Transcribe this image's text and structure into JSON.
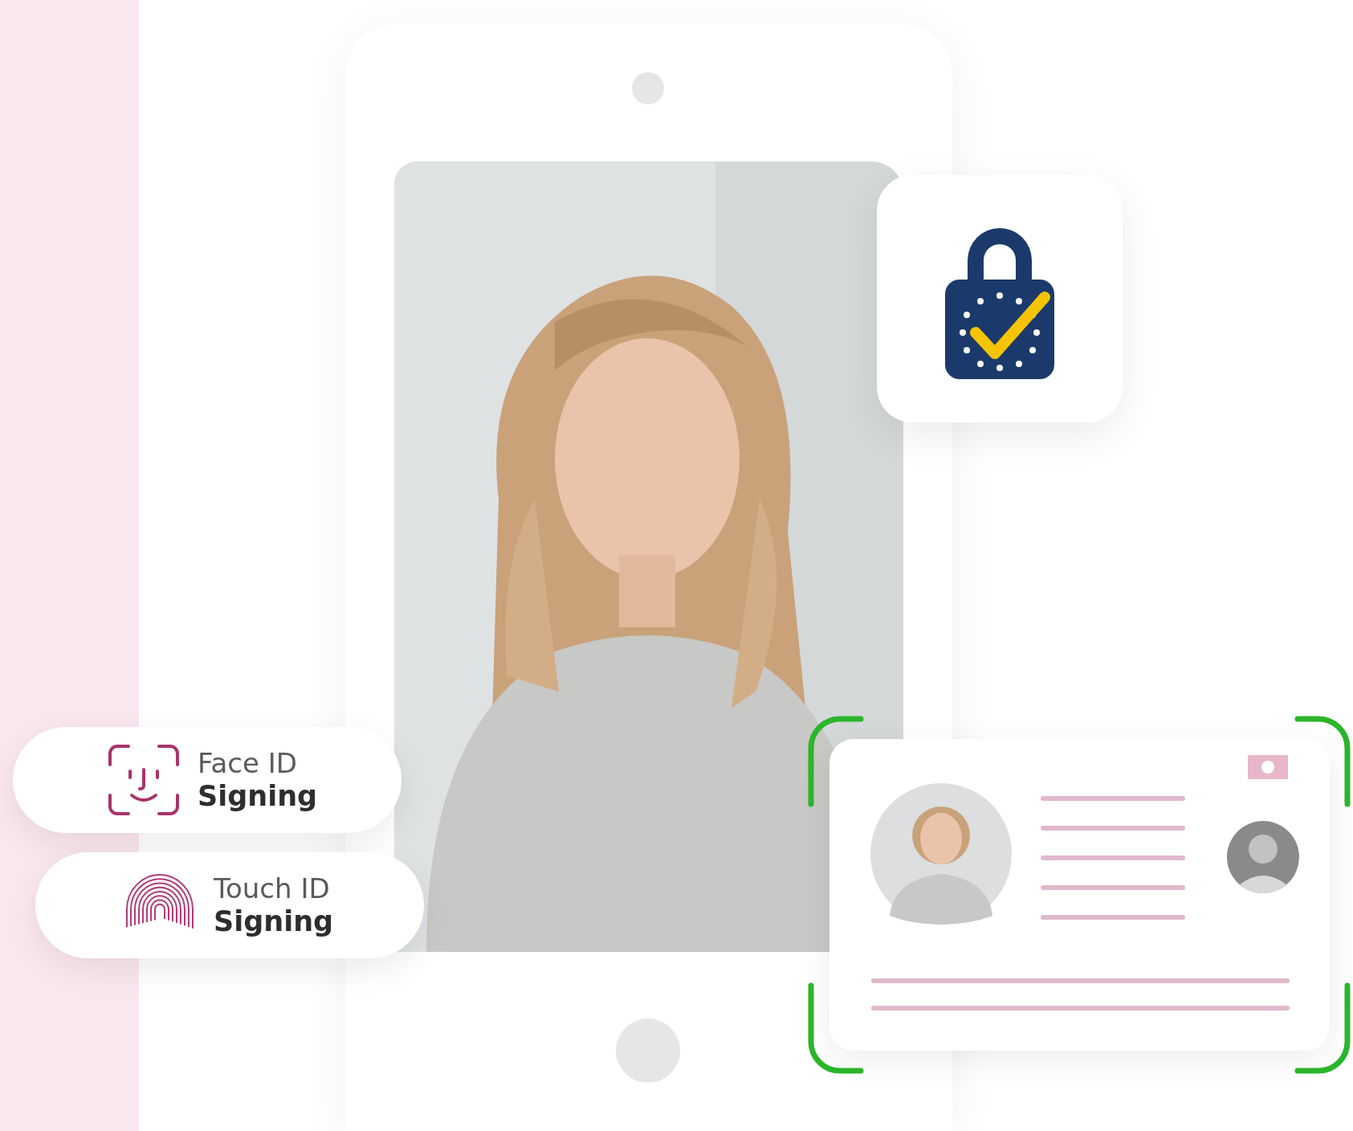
{
  "badges": [
    {
      "kind": "face",
      "title": "Face ID",
      "subtitle": "Signing"
    },
    {
      "kind": "touch",
      "title": "Touch ID",
      "subtitle": "Signing"
    }
  ]
}
